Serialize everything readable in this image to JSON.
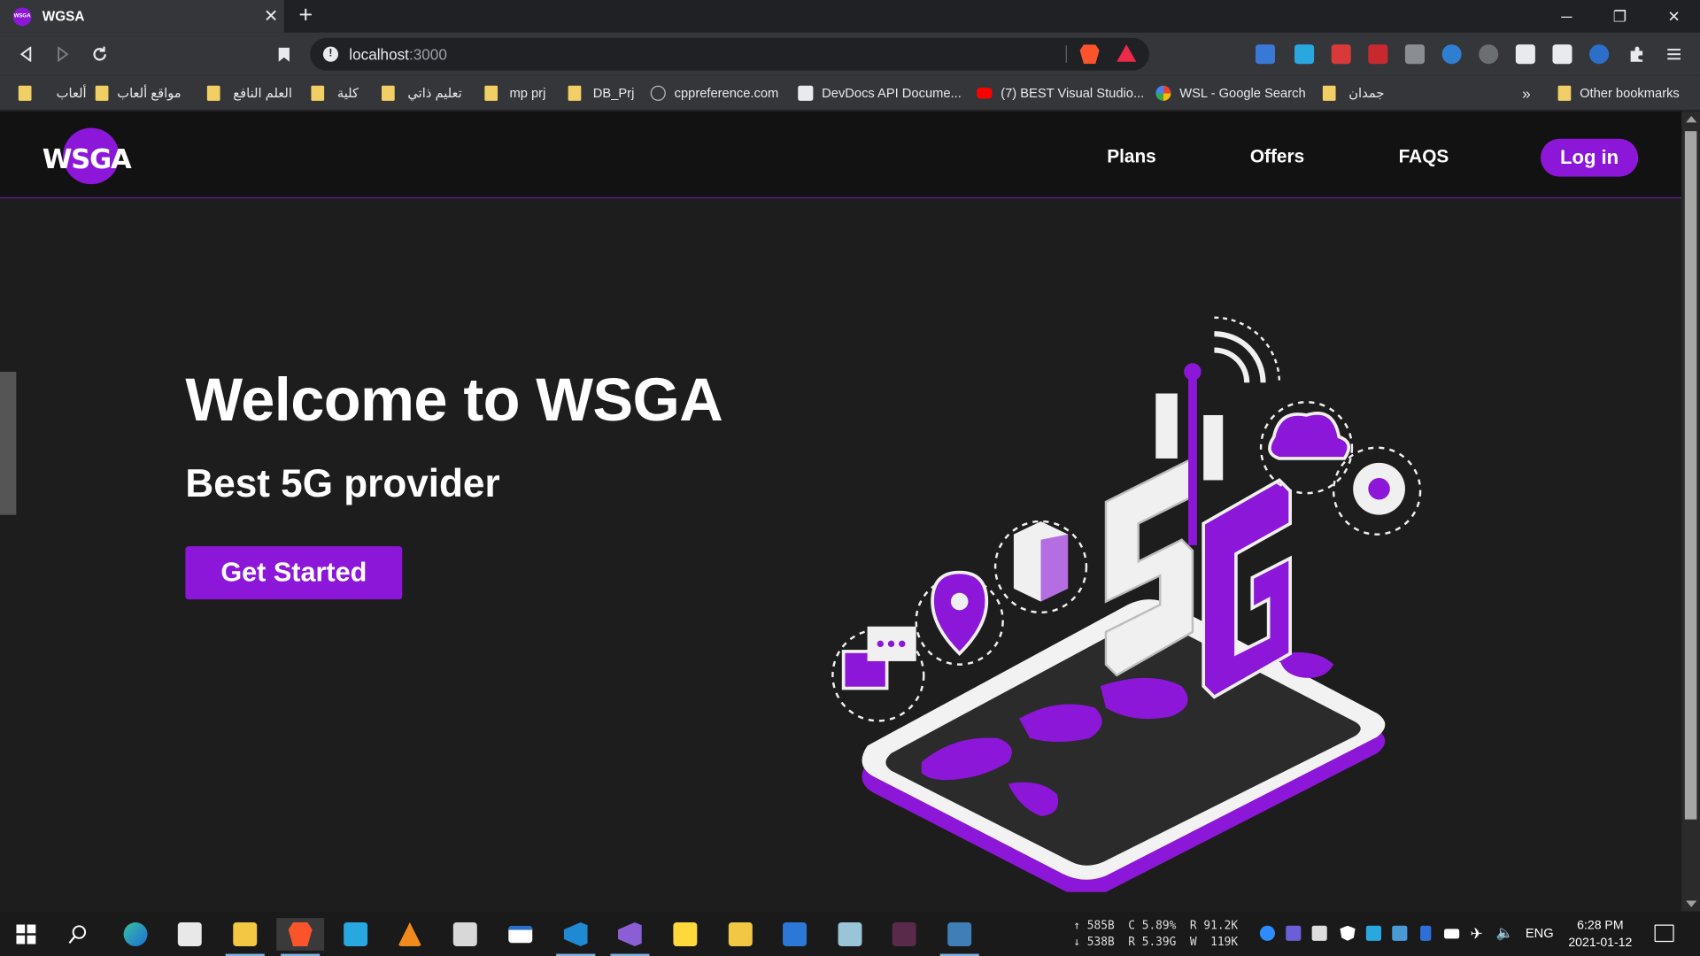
{
  "browser": {
    "tab_title": "WGSA",
    "tab_favicon_text": "WSGA",
    "url_host": "localhost",
    "url_port": ":3000",
    "controls": {
      "minimize": "─",
      "restore": "❐",
      "close": "✕",
      "new_tab": "+"
    }
  },
  "bookmarks": [
    {
      "label": "ألعاب",
      "type": "folder"
    },
    {
      "label": "مواقع ألعاب",
      "type": "folder"
    },
    {
      "label": "العلم النافع",
      "type": "folder"
    },
    {
      "label": "كلية",
      "type": "folder"
    },
    {
      "label": "تعليم ذاتي",
      "type": "folder"
    },
    {
      "label": "mp prj",
      "type": "folder"
    },
    {
      "label": "DB_Prj",
      "type": "folder"
    },
    {
      "label": "cppreference.com",
      "type": "site"
    },
    {
      "label": "DevDocs API Docume...",
      "type": "site"
    },
    {
      "label": "(7) BEST Visual Studio...",
      "type": "site"
    },
    {
      "label": "WSL - Google Search",
      "type": "site"
    },
    {
      "label": "جمدان",
      "type": "folder"
    }
  ],
  "bookmarks_overflow": "»",
  "other_bookmarks": "Other bookmarks",
  "site": {
    "logo_text": "WSGA",
    "nav": {
      "plans": "Plans",
      "offers": "Offers",
      "faqs": "FAQS",
      "login": "Log in"
    },
    "hero": {
      "title": "Welcome to WSGA",
      "subtitle": "Best 5G provider",
      "cta": "Get Started"
    },
    "illustration_text": "5G",
    "colors": {
      "accent": "#8c17d9",
      "background": "#1d1d1d",
      "navbar": "#121212"
    }
  },
  "taskbar": {
    "netstats": {
      "up": "585B",
      "down": "538B",
      "cpu": "C 5.89%",
      "ram": "R 5.39G",
      "disk_read": "R 91.2K",
      "disk_write": "W  119K"
    },
    "language": "ENG",
    "time": "6:28 PM",
    "date": "2021-01-12"
  }
}
